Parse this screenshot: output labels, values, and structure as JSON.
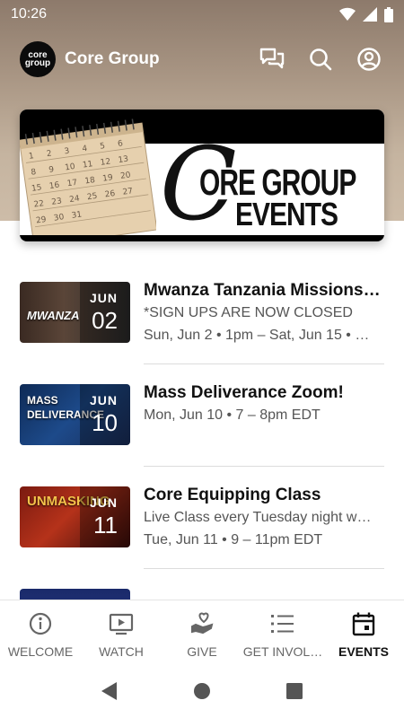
{
  "status_bar": {
    "time": "10:26"
  },
  "app_bar": {
    "logo_text_line1": "core",
    "logo_text_line2": "group",
    "title": "Core Group",
    "icons": [
      "chat-icon",
      "search-icon",
      "account-icon"
    ]
  },
  "banner": {
    "c_letter": "C",
    "line1": "ORE GROUP",
    "line2": "EVENTS"
  },
  "events": [
    {
      "month": "JUN",
      "day": "02",
      "thumb_text": "MWANZA",
      "title": "Mwanza Tanzania Missions …",
      "line1": "*SIGN UPS ARE NOW CLOSED",
      "line2": "Sun, Jun 2 • 1pm – Sat, Jun 15 • …"
    },
    {
      "month": "JUN",
      "day": "10",
      "thumb_text": "MASS DELIVERANCE",
      "title": "Mass Deliverance Zoom!",
      "line1": "Mon, Jun 10 • 7 – 8pm EDT",
      "line2": ""
    },
    {
      "month": "JUN",
      "day": "11",
      "thumb_text": "UNMASKING",
      "title": "Core Equipping Class",
      "line1": "Live Class every Tuesday night w…",
      "line2": "Tue, Jun 11 • 9 – 11pm EDT"
    }
  ],
  "bottom_nav": [
    {
      "label": "WELCOME",
      "icon": "info-icon"
    },
    {
      "label": "WATCH",
      "icon": "tv-play-icon"
    },
    {
      "label": "GIVE",
      "icon": "heart-hand-icon"
    },
    {
      "label": "GET INVOL…",
      "icon": "list-icon"
    },
    {
      "label": "EVENTS",
      "icon": "calendar-icon",
      "active": true
    }
  ],
  "colors": {
    "hero_top": "#8d7a6b",
    "hero_bottom": "#cdbca8",
    "text_primary": "#111111",
    "text_secondary": "#555555"
  }
}
